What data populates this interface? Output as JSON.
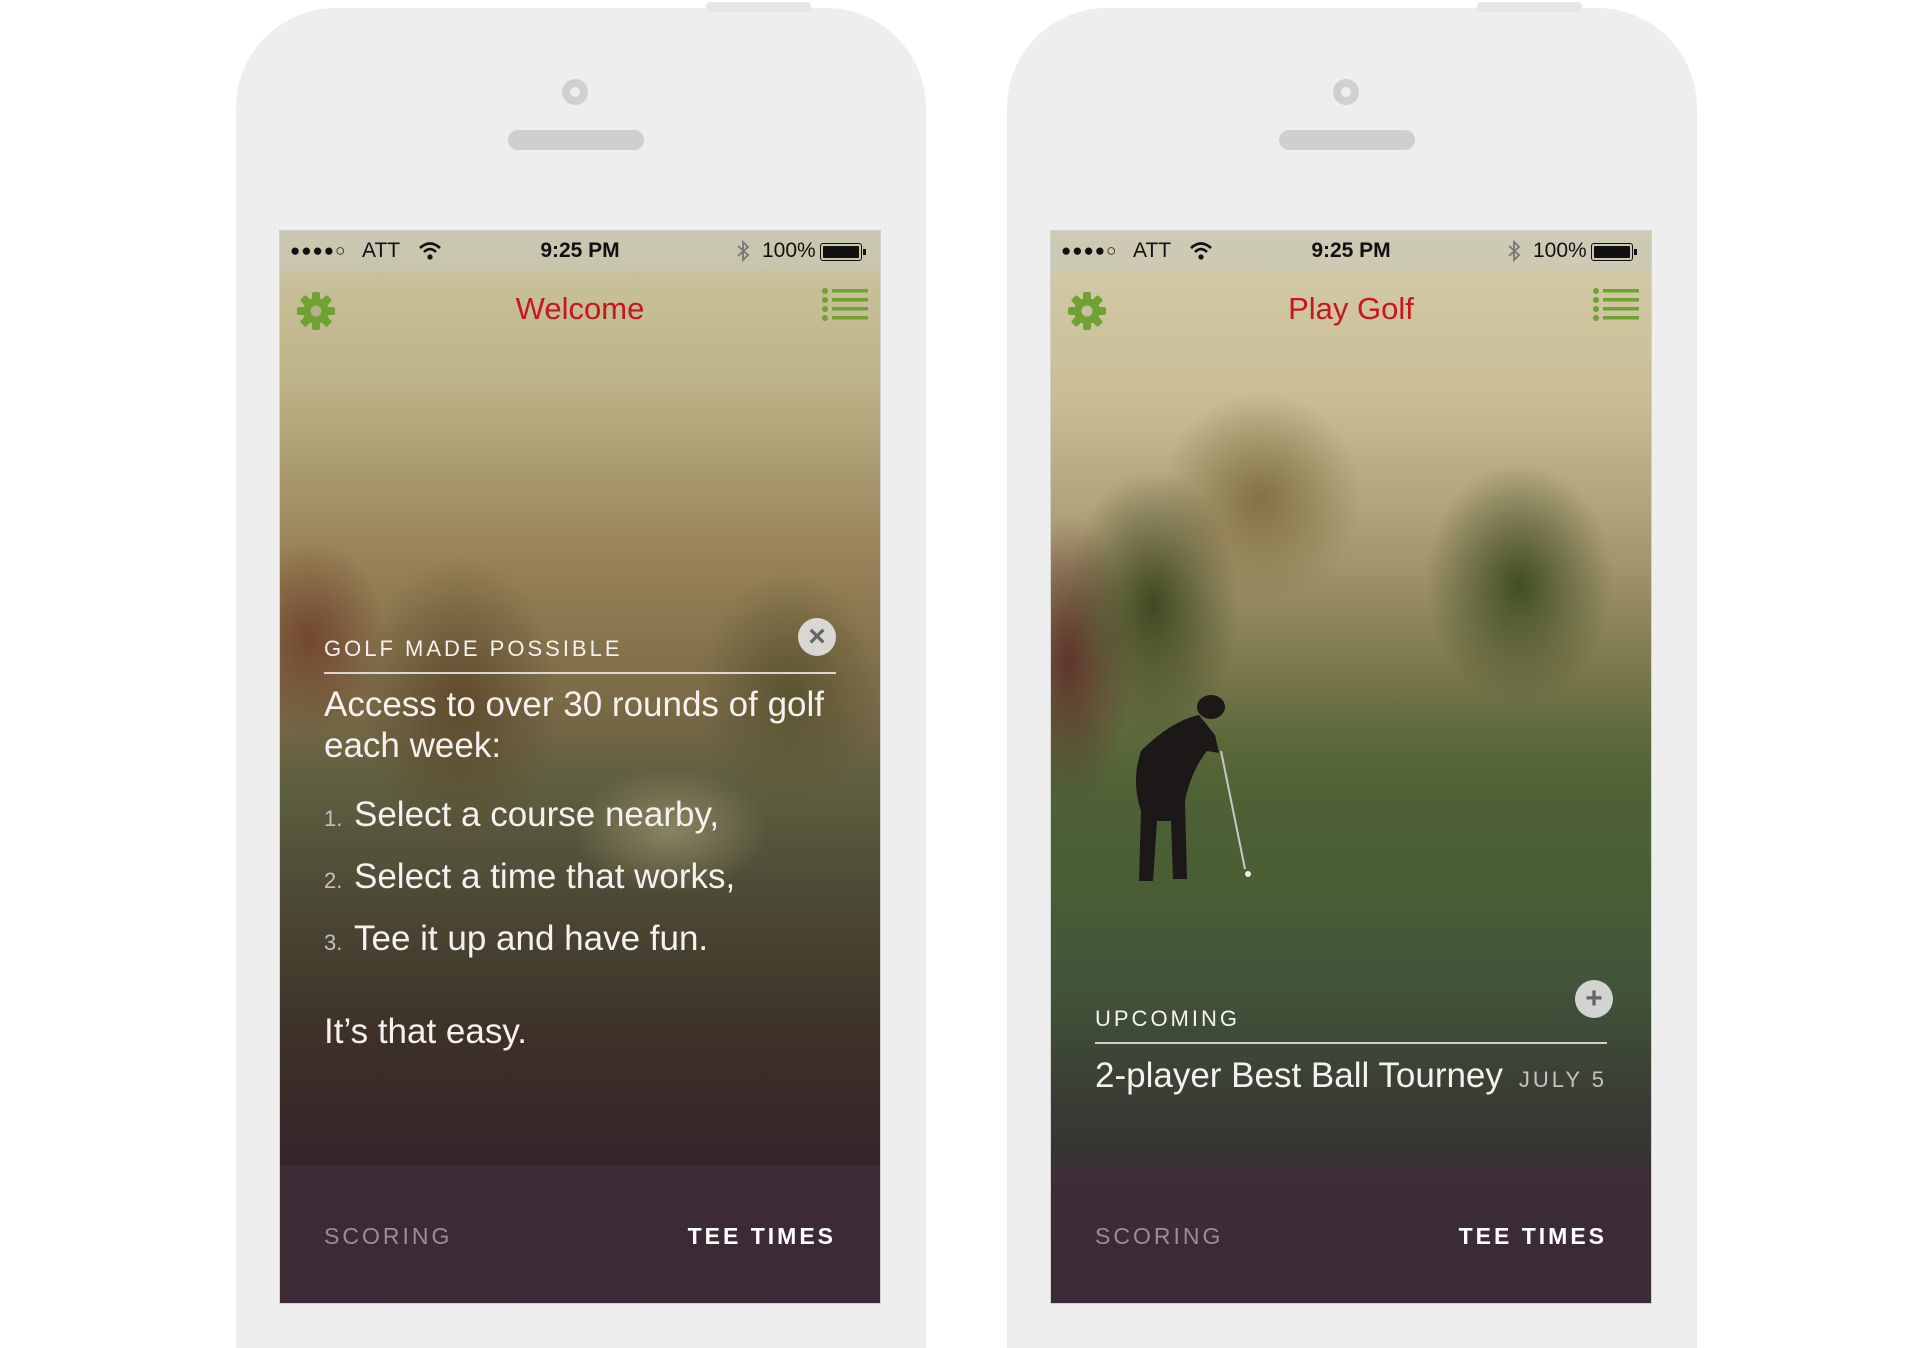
{
  "status_bar": {
    "signal": "●●●●○",
    "carrier": "ATT",
    "time": "9:25 PM",
    "battery": "100%"
  },
  "colors": {
    "brand_red": "#c8161d",
    "icon_green": "#6fa233"
  },
  "icons": {
    "settings": "gear-icon",
    "menu": "list-icon",
    "dismiss": "close-icon",
    "add": "plus-icon",
    "wifi": "wifi-icon",
    "bluetooth": "bluetooth-icon",
    "battery": "battery-icon"
  },
  "screen_welcome": {
    "title": "Welcome",
    "card": {
      "eyebrow": "GOLF MADE POSSIBLE",
      "lead": "Access to over 30 rounds of golf each week:",
      "steps": [
        {
          "num": "1.",
          "text": "Select a course nearby,"
        },
        {
          "num": "2.",
          "text": "Select a  time that works,"
        },
        {
          "num": "3.",
          "text": "Tee it up and have fun."
        }
      ],
      "outro": "It’s that easy."
    },
    "tabs": {
      "scoring": "SCORING",
      "tee_times": "TEE TIMES"
    }
  },
  "screen_play": {
    "title": "Play Golf",
    "upcoming": {
      "eyebrow": "UPCOMING",
      "event": "2-player Best Ball Tourney",
      "date": "JULY 5"
    },
    "tabs": {
      "scoring": "SCORING",
      "tee_times": "TEE TIMES"
    }
  }
}
